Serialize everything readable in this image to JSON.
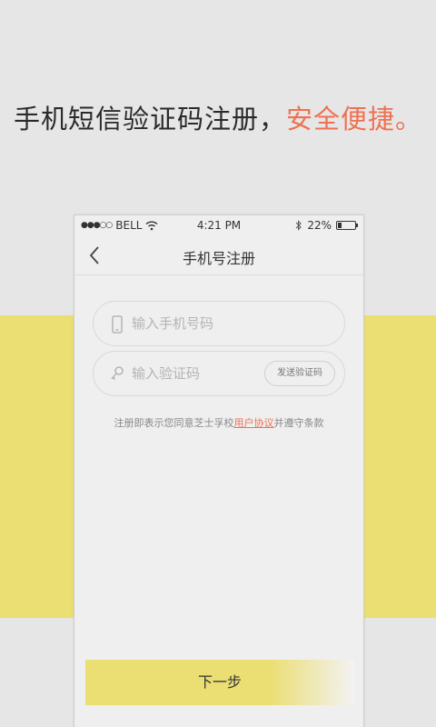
{
  "headline": {
    "main": "手机短信验证码注册，",
    "accent": "安全便捷。"
  },
  "status_bar": {
    "signal": "●●●○○",
    "carrier": "BELL",
    "time": "4:21 PM",
    "battery": "22%",
    "battery_level": 0.22
  },
  "nav": {
    "title": "手机号注册"
  },
  "phone_field": {
    "placeholder": "输入手机号码",
    "value": ""
  },
  "code_field": {
    "placeholder": "输入验证码",
    "value": "",
    "send_code_label": "发送验证码"
  },
  "agreement": {
    "before": "注册即表示您同意芝士孚校",
    "link": "用户协议",
    "after": "并遵守条款"
  },
  "next_button": {
    "label": "下一步"
  },
  "colors": {
    "accent": "#ee7152",
    "yellow": "#ebde72",
    "background": "#e6e6e6"
  }
}
